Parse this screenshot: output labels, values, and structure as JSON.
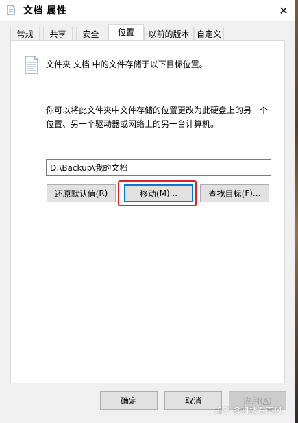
{
  "window": {
    "title": "文档 属性",
    "close_glyph": "✕"
  },
  "tabs": [
    {
      "label": "常规",
      "active": false
    },
    {
      "label": "共享",
      "active": false
    },
    {
      "label": "安全",
      "active": false
    },
    {
      "label": "位置",
      "active": true
    },
    {
      "label": "以前的版本",
      "active": false
    },
    {
      "label": "自定义",
      "active": false
    }
  ],
  "location_tab": {
    "info_text": "文件夹 文档 中的文件存储于以下目标位置。",
    "description_line1": "你可以将此文件夹中文件存储的位置更改为此硬盘上的另一个",
    "description_line2": "位置、另一个驱动器或网络上的另一台计算机。",
    "path_value": "D:\\Backup\\我的文档",
    "buttons": {
      "restore": {
        "label": "还原默认值(",
        "key": "R",
        "tail": ")"
      },
      "move": {
        "label": "移动(",
        "key": "M",
        "tail": ")..."
      },
      "find": {
        "label": "查找目标(",
        "key": "F",
        "tail": ")..."
      }
    }
  },
  "footer": {
    "ok_label": "确定",
    "cancel_label": "取消",
    "apply": {
      "label": "应用(",
      "key": "A",
      "tail": ")",
      "disabled": true
    }
  },
  "watermark": "知乎 @科技东南风",
  "colors": {
    "highlight": "#e0202b",
    "default_button_border": "#0078d7"
  }
}
